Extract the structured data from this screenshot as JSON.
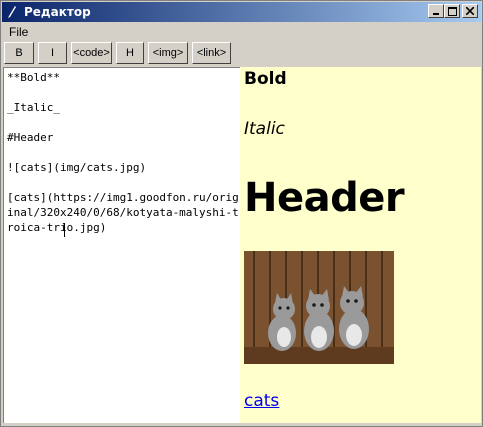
{
  "window": {
    "title": "Редактор",
    "controls": [
      "minimize",
      "maximize",
      "close"
    ]
  },
  "menu": {
    "items": [
      "File"
    ]
  },
  "toolbar": {
    "buttons": [
      "B",
      "I",
      "<code>",
      "H",
      "<img>",
      "<link>"
    ]
  },
  "editor": {
    "text": "**Bold**\n\n_Italic_\n\n#Header\n\n![cats](img/cats.jpg)\n\n[cats](https://img1.goodfon.ru/original/320x240/0/68/kotyata-malyshi-troica-trio.jpg)"
  },
  "preview": {
    "bold": "Bold",
    "italic": "Italic",
    "header": "Header",
    "image_alt": "cats",
    "link": "cats"
  },
  "colors": {
    "titlebar_start": "#0a246a",
    "titlebar_end": "#a6caf0",
    "window_bg": "#d4d0c8",
    "preview_bg": "#ffffcc",
    "link": "#0000ee"
  }
}
